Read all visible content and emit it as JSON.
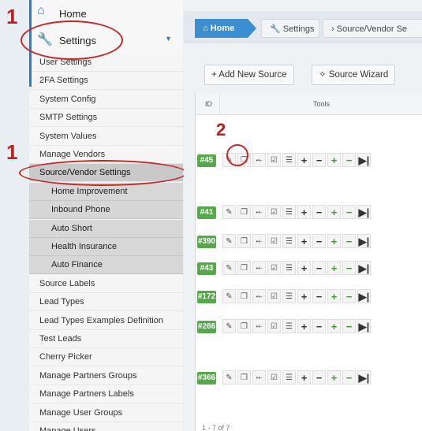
{
  "annotations": {
    "step1": "1",
    "step2": "2"
  },
  "sidebar": {
    "home_label": "Home",
    "settings_label": "Settings",
    "items": [
      "User Settings",
      "2FA Settings",
      "System Config",
      "SMTP Settings",
      "System Values",
      "Manage Vendors",
      "Source/Vendor Settings"
    ],
    "sub_items": [
      "Home Improvement",
      "Inbound Phone",
      "Auto Short",
      "Health Insurance",
      "Auto Finance"
    ],
    "items_after": [
      "Source Labels",
      "Lead Types",
      "Lead Types Examples Definition",
      "Test Leads",
      "Cherry Picker",
      "Manage Partners Groups",
      "Manage Partners Labels",
      "Manage User Groups",
      "Manage Users"
    ]
  },
  "breadcrumb": {
    "home": "Home",
    "settings": "Settings",
    "source_vendor": "Source/Vendor Se"
  },
  "toolbar": {
    "add_new_source": "+ Add New Source",
    "source_wizard": "Source Wizard"
  },
  "grid": {
    "col_id": "ID",
    "col_tools": "Tools",
    "rows": [
      "#45",
      "#41",
      "#390",
      "#43",
      "#172",
      "#266",
      "#366"
    ]
  },
  "footer": "1 - 7 of 7",
  "colors": {
    "accent": "#3b8ed0",
    "id_badge": "#57a84c",
    "annotation": "#c4292a"
  }
}
